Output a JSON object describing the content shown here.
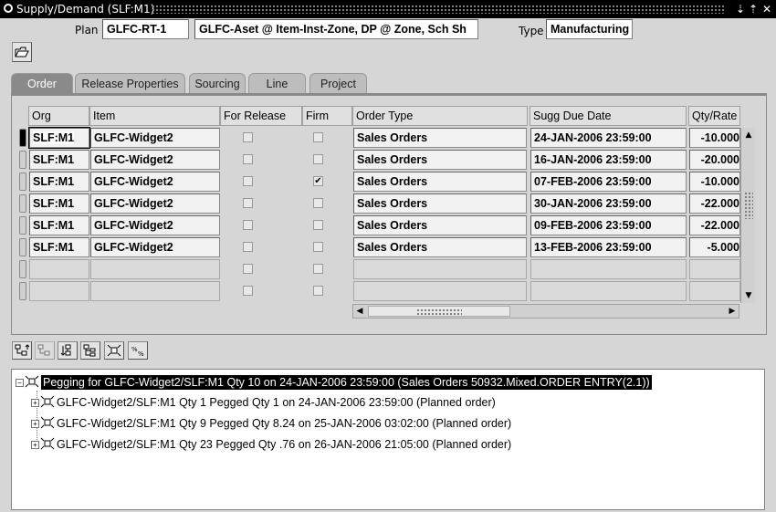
{
  "window": {
    "title": "Supply/Demand (SLF:M1)",
    "controls": [
      "⇣",
      "⇡",
      "✕"
    ]
  },
  "header": {
    "plan_label": "Plan",
    "plan_value": "GLFC-RT-1",
    "plan_desc": "GLFC-Aset @ Item-Inst-Zone, DP @ Zone, Sch Sh",
    "type_label": "Type",
    "type_value": "Manufacturing"
  },
  "tabs": [
    {
      "label": "Order",
      "active": true
    },
    {
      "label": "Release Properties",
      "active": false
    },
    {
      "label": "Sourcing",
      "active": false
    },
    {
      "label": "Line",
      "active": false
    },
    {
      "label": "Project",
      "active": false
    }
  ],
  "table": {
    "columns": [
      "Org",
      "Item",
      "For Release",
      "Firm",
      "Order Type",
      "Sugg Due Date",
      "Qty/Rate"
    ],
    "rows": [
      {
        "org": "SLF:M1",
        "item": "GLFC-Widget2",
        "for_release": false,
        "firm": false,
        "order_type": "Sales Orders",
        "due": "24-JAN-2006 23:59:00",
        "qty": "-10.000"
      },
      {
        "org": "SLF:M1",
        "item": "GLFC-Widget2",
        "for_release": false,
        "firm": false,
        "order_type": "Sales Orders",
        "due": "16-JAN-2006 23:59:00",
        "qty": "-20.000"
      },
      {
        "org": "SLF:M1",
        "item": "GLFC-Widget2",
        "for_release": false,
        "firm": true,
        "order_type": "Sales Orders",
        "due": "07-FEB-2006 23:59:00",
        "qty": "-10.000"
      },
      {
        "org": "SLF:M1",
        "item": "GLFC-Widget2",
        "for_release": false,
        "firm": false,
        "order_type": "Sales Orders",
        "due": "30-JAN-2006 23:59:00",
        "qty": "-22.000"
      },
      {
        "org": "SLF:M1",
        "item": "GLFC-Widget2",
        "for_release": false,
        "firm": false,
        "order_type": "Sales Orders",
        "due": "09-FEB-2006 23:59:00",
        "qty": "-22.000"
      },
      {
        "org": "SLF:M1",
        "item": "GLFC-Widget2",
        "for_release": false,
        "firm": false,
        "order_type": "Sales Orders",
        "due": "13-FEB-2006 23:59:00",
        "qty": "-5.000"
      }
    ],
    "empty_rows": 2
  },
  "pegging": {
    "root": "Pegging for GLFC-Widget2/SLF:M1 Qty 10 on 24-JAN-2006 23:59:00 (Sales Orders 50932.Mixed.ORDER ENTRY(2.1))",
    "children": [
      "GLFC-Widget2/SLF:M1 Qty 1 Pegged Qty 1 on 24-JAN-2006 23:59:00 (Planned order)",
      "GLFC-Widget2/SLF:M1 Qty 9 Pegged Qty 8.24 on 25-JAN-2006 03:02:00 (Planned order)",
      "GLFC-Widget2/SLF:M1 Qty 23 Pegged Qty .76 on 26-JAN-2006 21:05:00 (Planned order)"
    ]
  },
  "icons": {
    "open_folder": "open-folder-icon",
    "tree_toolbar": [
      "expand-up-icon",
      "collapse-icon",
      "expand-down-icon",
      "expand-all-icon",
      "explode-icon",
      "percent-icon"
    ]
  }
}
